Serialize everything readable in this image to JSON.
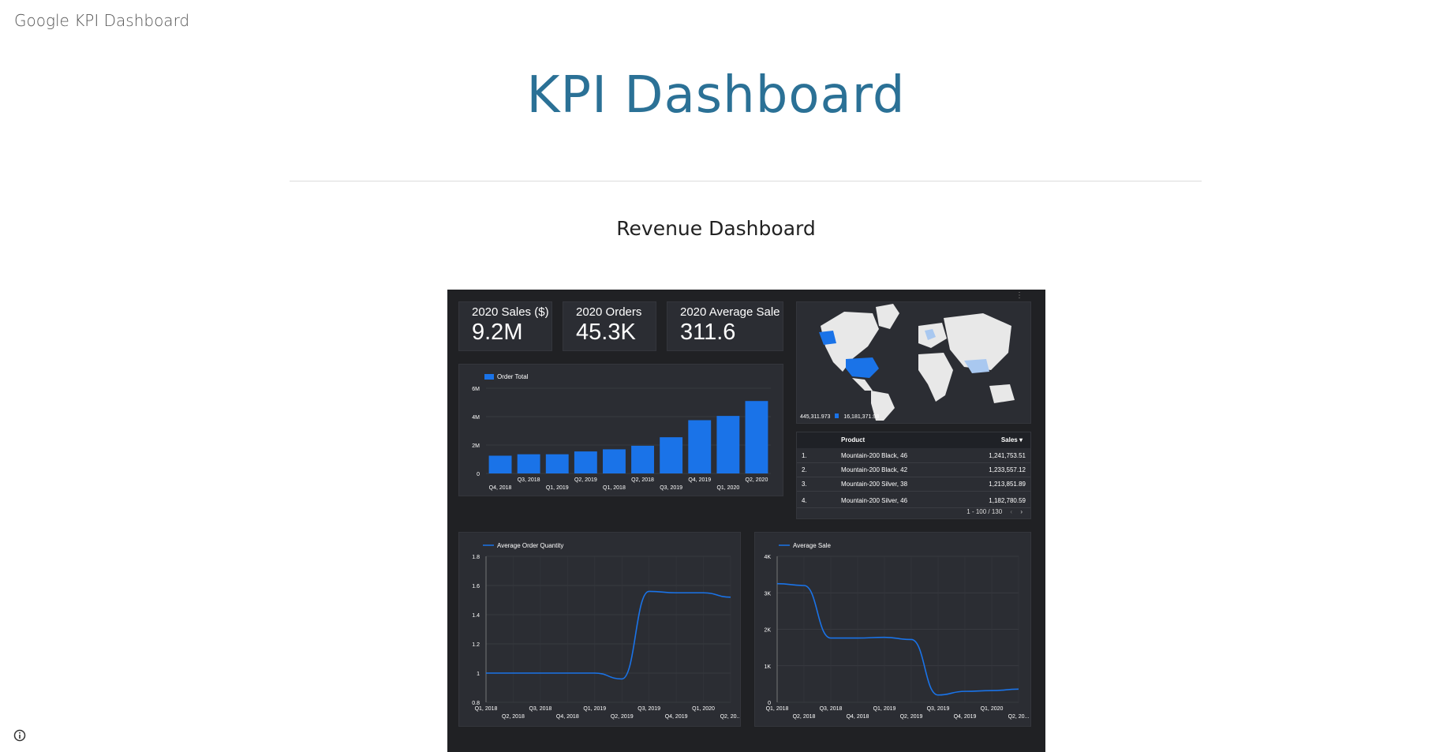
{
  "site": {
    "name": "Google KPI Dashboard"
  },
  "page": {
    "title": "KPI Dashboard",
    "section_title": "Revenue Dashboard"
  },
  "kpis": [
    {
      "label": "2020 Sales ($)",
      "value": "9.2M"
    },
    {
      "label": "2020 Orders",
      "value": "45.3K"
    },
    {
      "label": "2020 Average Sale",
      "value": "311.6"
    }
  ],
  "map": {
    "legend_min": "445,311.973",
    "legend_max": "16,181,371.98",
    "colors": {
      "highlight": "#1a73e8",
      "land": "#e8e8e8",
      "light": "#a9c8f0"
    }
  },
  "table": {
    "columns": [
      "Product",
      "Sales ▾"
    ],
    "rows": [
      {
        "rank": "1.",
        "product": "Mountain-200 Black, 46",
        "sales": "1,241,753.51"
      },
      {
        "rank": "2.",
        "product": "Mountain-200 Black, 42",
        "sales": "1,233,557.12"
      },
      {
        "rank": "3.",
        "product": "Mountain-200 Silver, 38",
        "sales": "1,213,851.89"
      },
      {
        "rank": "4.",
        "product": "Mountain-200 Silver, 46",
        "sales": "1,182,780.59"
      }
    ],
    "pager": "1 - 100 / 130"
  },
  "colors": {
    "accent": "#1a73e8",
    "panel": "#2b2d33",
    "background": "#202124",
    "title": "#2b7196"
  },
  "chart_data": [
    {
      "type": "bar",
      "legend": [
        "Order Total"
      ],
      "legend_position": "top-left",
      "categories": [
        "Q4, 2018",
        "Q3, 2018",
        "Q1, 2019",
        "Q2, 2019",
        "Q1, 2018",
        "Q2, 2018",
        "Q3, 2019",
        "Q4, 2019",
        "Q1, 2020",
        "Q2, 2020"
      ],
      "series": [
        {
          "name": "Order Total",
          "values": [
            1250000,
            1350000,
            1350000,
            1550000,
            1700000,
            1950000,
            2550000,
            3750000,
            4050000,
            5100000
          ]
        }
      ],
      "y_ticks": [
        "0",
        "2M",
        "4M",
        "6M"
      ],
      "ylim": [
        0,
        6000000
      ],
      "grid": true
    },
    {
      "type": "line",
      "legend": [
        "Average Order Quantity"
      ],
      "legend_position": "top-left",
      "x_ticks_top": [
        "Q1, 2018",
        "Q3, 2018",
        "Q1, 2019",
        "Q3, 2019",
        "Q1, 2020"
      ],
      "x_ticks_bottom": [
        "Q2, 2018",
        "Q4, 2018",
        "Q2, 2019",
        "Q4, 2019",
        "Q2, 20..."
      ],
      "series": [
        {
          "name": "Average Order Quantity",
          "values": [
            1.0,
            1.0,
            1.0,
            1.0,
            1.0,
            0.96,
            1.56,
            1.55,
            1.55,
            1.52
          ]
        }
      ],
      "y_ticks": [
        "0.8",
        "1",
        "1.2",
        "1.4",
        "1.6",
        "1.8"
      ],
      "ylim": [
        0.8,
        1.8
      ],
      "grid": true
    },
    {
      "type": "line",
      "legend": [
        "Average Sale"
      ],
      "legend_position": "top-left",
      "x_ticks_top": [
        "Q1, 2018",
        "Q3, 2018",
        "Q1, 2019",
        "Q3, 2019",
        "Q1, 2020"
      ],
      "x_ticks_bottom": [
        "Q2, 2018",
        "Q4, 2018",
        "Q2, 2019",
        "Q4, 2019",
        "Q2, 20..."
      ],
      "series": [
        {
          "name": "Average Sale",
          "values": [
            3250,
            3200,
            1760,
            1760,
            1780,
            1720,
            200,
            300,
            320,
            360
          ]
        }
      ],
      "y_ticks": [
        "0",
        "1K",
        "2K",
        "3K",
        "4K"
      ],
      "ylim": [
        0,
        4000
      ],
      "grid": true
    }
  ]
}
